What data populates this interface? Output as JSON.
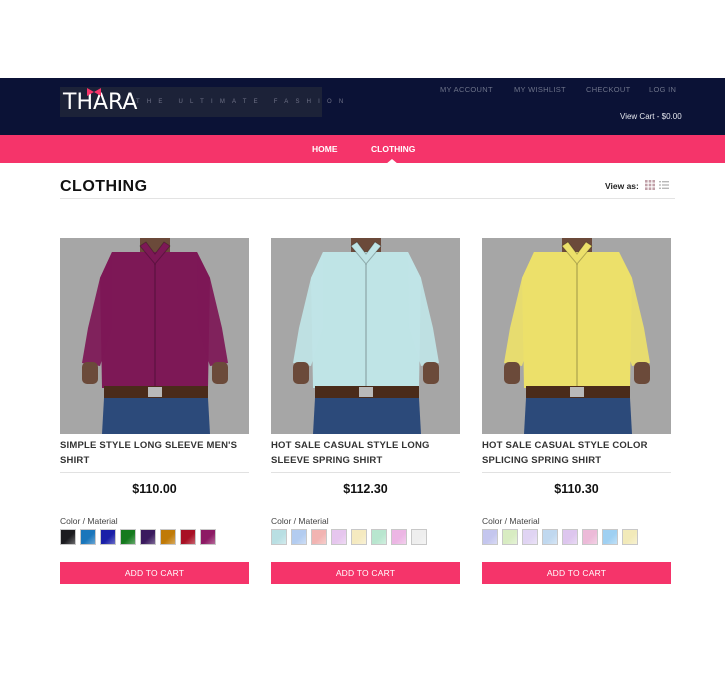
{
  "header": {
    "logo_text": "THARA",
    "tagline": "THE ULTIMATE FASHION",
    "top_links": [
      "MY ACCOUNT",
      "MY WISHLIST",
      "CHECKOUT",
      "LOG IN"
    ],
    "view_cart": "View Cart - $0.00"
  },
  "nav": {
    "items": [
      "HOME",
      "CLOTHING"
    ],
    "active": "CLOTHING"
  },
  "page": {
    "title": "CLOTHING",
    "view_as_label": "View as:"
  },
  "colors": {
    "header_bg": "#0b1236",
    "accent": "#f5346a"
  },
  "products": [
    {
      "name": "SIMPLE STYLE LONG SLEEVE MEN'S SHIRT",
      "price": "$110.00",
      "color_label": "Color / Material",
      "button": "ADD TO CART",
      "shirt_color": "#7d1856",
      "swatches": [
        "#1b1b1f",
        "#1a76bb",
        "#1a1fa8",
        "#157a1e",
        "#3a1a5e",
        "#c07a07",
        "#a81024",
        "#8d1a64"
      ]
    },
    {
      "name": "HOT SALE CASUAL STYLE LONG SLEEVE SPRING SHIRT",
      "price": "$112.30",
      "color_label": "Color / Material",
      "button": "ADD TO CART",
      "shirt_color": "#bfe4e6",
      "swatches": [
        "#b9dfe3",
        "#b3ccf0",
        "#f2b4b2",
        "#e6c6ee",
        "#f5eac0",
        "#b8e6cf",
        "#ecb6e4",
        "#eeeeee"
      ]
    },
    {
      "name": "HOT SALE CASUAL STYLE COLOR SPLICING SPRING SHIRT",
      "price": "$110.30",
      "color_label": "Color / Material",
      "button": "ADD TO CART",
      "shirt_color": "#ece06a",
      "swatches": [
        "#c4c6ee",
        "#d8ecc2",
        "#e0d4f3",
        "#c0d8ef",
        "#ddc6ee",
        "#ecbad8",
        "#9fd0f2",
        "#f2eab9"
      ]
    }
  ]
}
